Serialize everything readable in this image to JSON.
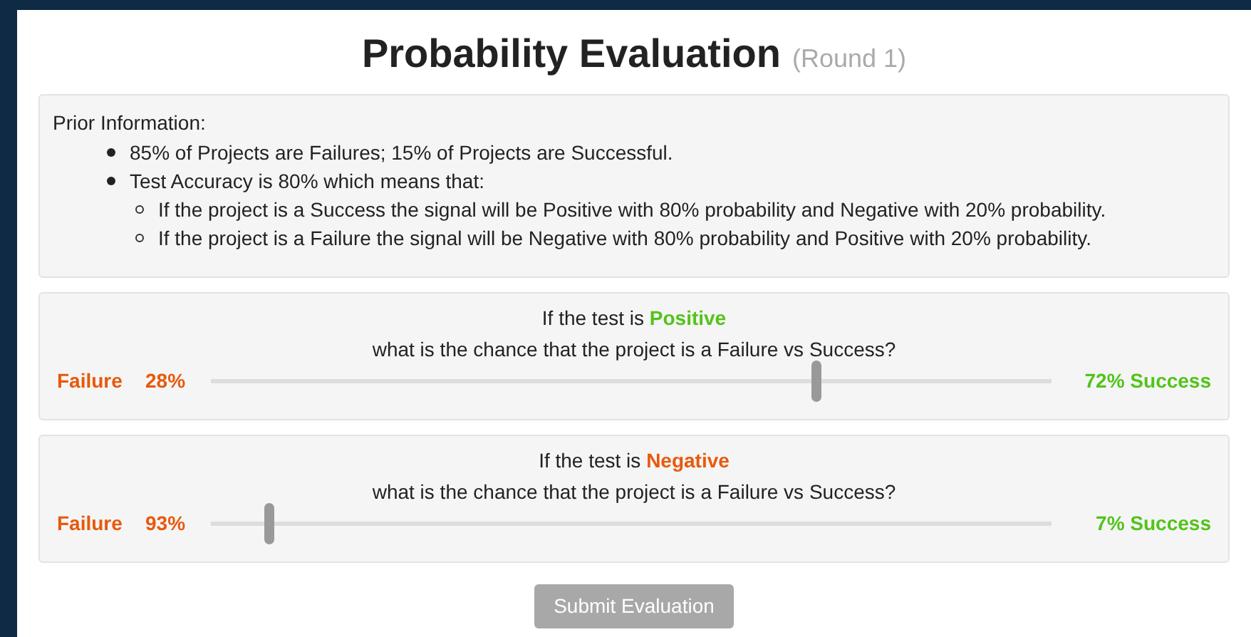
{
  "title": "Probability Evaluation",
  "subtitle": "(Round 1)",
  "prior": {
    "heading": "Prior Information:",
    "items": [
      {
        "text": "85% of Projects are Failures; 15% of Projects are Successful."
      },
      {
        "text": "Test Accuracy is 80% which means that:",
        "children": [
          {
            "text": "If the project is a Success the signal will be Positive with 80% probability and Negative with 20% probability."
          },
          {
            "text": "If the project is a Failure the signal will be Negative with 80% probability and Positive with 20% probability."
          }
        ]
      }
    ]
  },
  "questions": [
    {
      "prefix": "If the test is",
      "signal": "Positive",
      "color": "#52c41a",
      "question": "what is the chance that the project is a Failure vs Success?",
      "failure_label": "Failure",
      "failure_value": "28%",
      "success_text": "72% Success",
      "level": 0.72
    },
    {
      "prefix": "If the test is",
      "signal": "Negative",
      "color": "#e8590c",
      "question": "what is the chance that the project is a Failure vs Success?",
      "failure_label": "Failure",
      "failure_value": "93%",
      "success_text": "7% Success",
      "level": 0.07
    }
  ],
  "submit": {
    "label": "Submit Evaluation",
    "disabled": true
  }
}
